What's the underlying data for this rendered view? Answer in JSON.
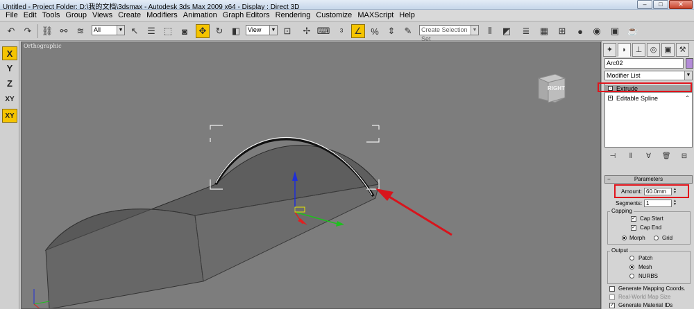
{
  "window": {
    "title": "Untitled     - Project Folder: D:\\我的文档\\3dsmax     - Autodesk 3ds Max  2009 x64      - Display : Direct 3D",
    "minimize": "–",
    "maximize": "□",
    "close": "✕"
  },
  "menu": [
    "File",
    "Edit",
    "Tools",
    "Group",
    "Views",
    "Create",
    "Modifiers",
    "Animation",
    "Graph Editors",
    "Rendering",
    "Customize",
    "MAXScript",
    "Help"
  ],
  "toolbar": {
    "filter_value": "All",
    "refcoord_value": "View",
    "selection_set_placeholder": "Create Selection Set"
  },
  "axes": [
    "X",
    "Y",
    "Z",
    "XY",
    "XY"
  ],
  "viewport": {
    "label": "Orthographic",
    "viewcube_label": "RIGHT"
  },
  "command_panel": {
    "object_name": "Arc02",
    "object_color": "#b48cd8",
    "modifier_list": "Modifier List",
    "stack": [
      {
        "label": "Extrude",
        "selected": true
      },
      {
        "label": "Editable Spline",
        "selected": false
      }
    ],
    "parameters": {
      "title": "Parameters",
      "amount_label": "Amount:",
      "amount_value": "60.0mm",
      "segments_label": "Segments:",
      "segments_value": "1",
      "capping_label": "Capping",
      "cap_start": "Cap Start",
      "cap_end": "Cap End",
      "morph": "Morph",
      "grid": "Grid",
      "output_label": "Output",
      "patch": "Patch",
      "mesh": "Mesh",
      "nurbs": "NURBS",
      "gen_mapping": "Generate Mapping Coords.",
      "real_world": "Real-World Map Size",
      "gen_material": "Generate Material IDs"
    }
  },
  "highlight_color": "#e0141c"
}
